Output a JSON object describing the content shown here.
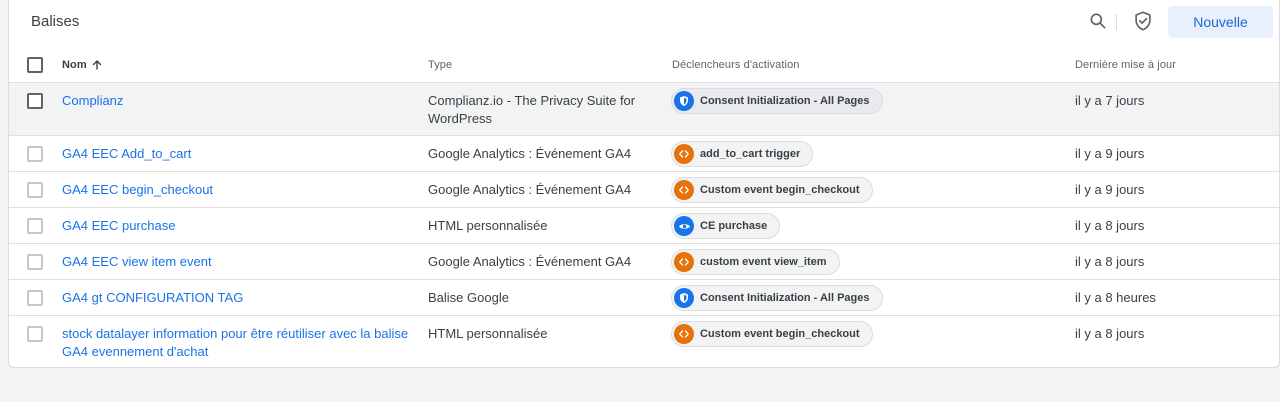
{
  "header": {
    "title": "Balises",
    "new_button": "Nouvelle"
  },
  "columns": {
    "name": "Nom",
    "type": "Type",
    "triggers": "Déclencheurs d'activation",
    "updated": "Dernière mise à jour"
  },
  "colors": {
    "link": "#1a73e8",
    "orange_trigger": "#e8710a",
    "blue_trigger": "#1a73e8",
    "selected_row": "#f1f3f4"
  },
  "rows": [
    {
      "name_lines": [
        "Complianz"
      ],
      "type_lines": [
        "Complianz.io - The Privacy Suite for",
        "WordPress"
      ],
      "trigger": "Consent Initialization - All Pages",
      "trigger_icon": "shield-icon",
      "updated": "il y a 7 jours"
    },
    {
      "name_lines": [
        "GA4 EEC Add_to_cart"
      ],
      "type_lines": [
        "Google Analytics : Événement GA4"
      ],
      "trigger": "add_to_cart trigger",
      "trigger_icon": "code-icon",
      "updated": "il y a 9 jours"
    },
    {
      "name_lines": [
        "GA4 EEC begin_checkout"
      ],
      "type_lines": [
        "Google Analytics : Événement GA4"
      ],
      "trigger": "Custom event begin_checkout",
      "trigger_icon": "code-icon",
      "updated": "il y a 9 jours"
    },
    {
      "name_lines": [
        "GA4 EEC purchase"
      ],
      "type_lines": [
        "HTML personnalisée"
      ],
      "trigger": "CE purchase",
      "trigger_icon": "eye-icon",
      "updated": "il y a 8 jours"
    },
    {
      "name_lines": [
        "GA4 EEC view item event"
      ],
      "type_lines": [
        "Google Analytics : Événement GA4"
      ],
      "trigger": "custom event view_item",
      "trigger_icon": "code-icon",
      "updated": "il y a 8 jours"
    },
    {
      "name_lines": [
        "GA4 gt CONFIGURATION TAG"
      ],
      "type_lines": [
        "Balise Google"
      ],
      "trigger": "Consent Initialization - All Pages",
      "trigger_icon": "shield-icon",
      "updated": "il y a 8 heures"
    },
    {
      "name_lines": [
        "stock datalayer information pour être réutiliser avec la balise",
        "GA4 evennement d'achat"
      ],
      "type_lines": [
        "HTML personnalisée"
      ],
      "trigger": "Custom event begin_checkout",
      "trigger_icon": "code-icon",
      "updated": "il y a 8 jours"
    }
  ]
}
